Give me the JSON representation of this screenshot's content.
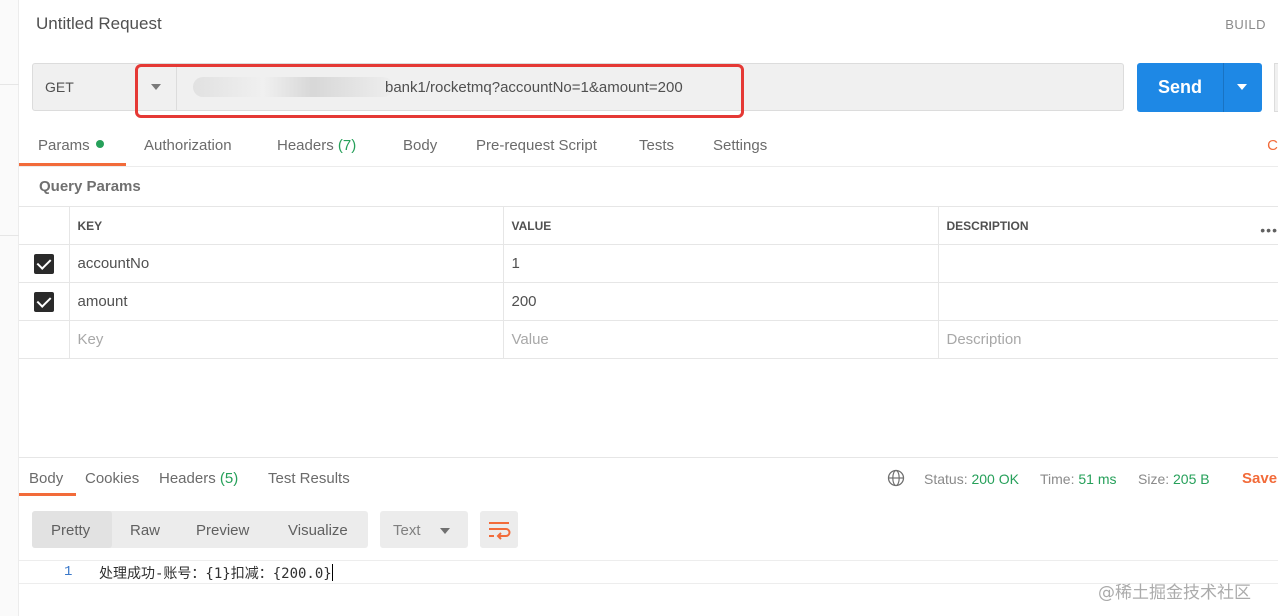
{
  "header": {
    "title": "Untitled Request",
    "build_label": "BUILD"
  },
  "request": {
    "method": "GET",
    "url": "bank1/rocketmq?accountNo=1&amount=200",
    "send_label": "Send"
  },
  "request_tabs": {
    "params": "Params",
    "authorization": "Authorization",
    "headers": "Headers",
    "headers_count": "(7)",
    "body": "Body",
    "prerequest": "Pre-request Script",
    "tests": "Tests",
    "settings": "Settings",
    "edge_clipped": "C"
  },
  "query_params": {
    "section_label": "Query Params",
    "columns": {
      "key": "KEY",
      "value": "VALUE",
      "description": "DESCRIPTION"
    },
    "rows": [
      {
        "key": "accountNo",
        "value": "1",
        "description": ""
      },
      {
        "key": "amount",
        "value": "200",
        "description": ""
      }
    ],
    "placeholders": {
      "key": "Key",
      "value": "Value",
      "description": "Description"
    },
    "more": "•••"
  },
  "response_tabs": {
    "body": "Body",
    "cookies": "Cookies",
    "headers": "Headers",
    "headers_count": "(5)",
    "test_results": "Test Results"
  },
  "response_meta": {
    "status_label": "Status:",
    "status_value": "200 OK",
    "time_label": "Time:",
    "time_value": "51 ms",
    "size_label": "Size:",
    "size_value": "205 B",
    "save_label": "Save"
  },
  "body_view": {
    "modes": [
      "Pretty",
      "Raw",
      "Preview",
      "Visualize"
    ],
    "format": "Text",
    "line_number": "1",
    "content": "处理成功-账号：{1}扣减：{200.0}"
  },
  "watermark": "@稀土掘金技术社区",
  "colors": {
    "accent": "#f26b3a",
    "send": "#1e88e5",
    "ok": "#26a05a",
    "highlight": "#e53935"
  }
}
